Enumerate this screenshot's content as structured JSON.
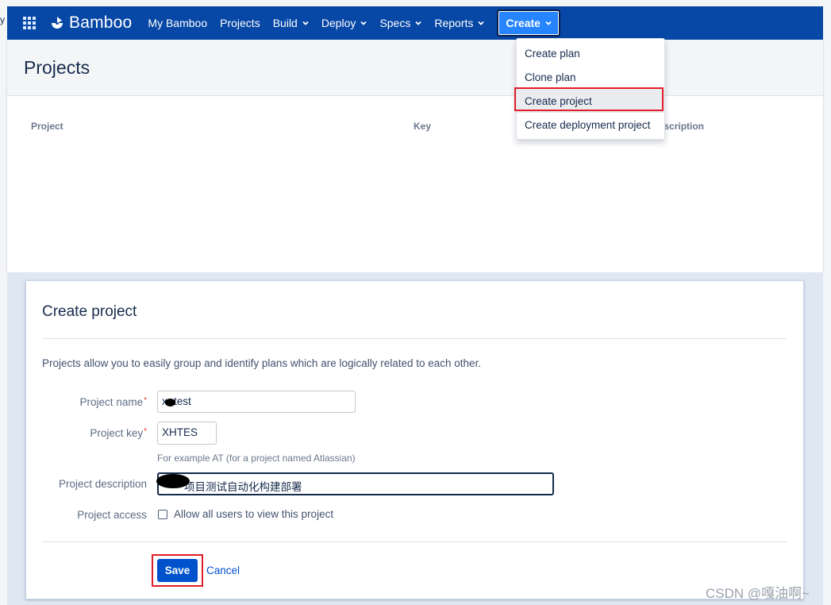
{
  "edge_text": "y",
  "navbar": {
    "brand": "Bamboo",
    "items": [
      {
        "label": "My Bamboo",
        "dropdown": false
      },
      {
        "label": "Projects",
        "dropdown": false
      },
      {
        "label": "Build",
        "dropdown": true
      },
      {
        "label": "Deploy",
        "dropdown": true
      },
      {
        "label": "Specs",
        "dropdown": true
      },
      {
        "label": "Reports",
        "dropdown": true
      }
    ],
    "create_label": "Create"
  },
  "projects_page": {
    "title": "Projects",
    "columns": [
      "Project",
      "Key",
      "Description"
    ]
  },
  "create_menu": {
    "items": [
      "Create plan",
      "Clone plan",
      "Create project",
      "Create deployment project"
    ],
    "highlighted": "Create project"
  },
  "dialog": {
    "title": "Create project",
    "description": "Projects allow you to easily group and identify plans which are logically related to each other.",
    "fields": {
      "project_name": {
        "label": "Project name",
        "required": "*",
        "value": "x -test"
      },
      "project_key": {
        "label": "Project key",
        "required": "*",
        "value": "XHTES",
        "hint": "For example AT (for a project named Atlassian)"
      },
      "project_description": {
        "label": "Project description",
        "value": "项目测试自动化构建部署"
      },
      "project_access": {
        "label": "Project access",
        "checkbox_label": "Allow all users to view this project",
        "checked": false
      }
    },
    "save_label": "Save",
    "cancel_label": "Cancel"
  },
  "watermark": "CSDN @嘎油啊~",
  "colors": {
    "nav": "#0747a6",
    "create_button": "#2684ff",
    "primary": "#0052cc",
    "annotation_red": "#e01e2a"
  }
}
